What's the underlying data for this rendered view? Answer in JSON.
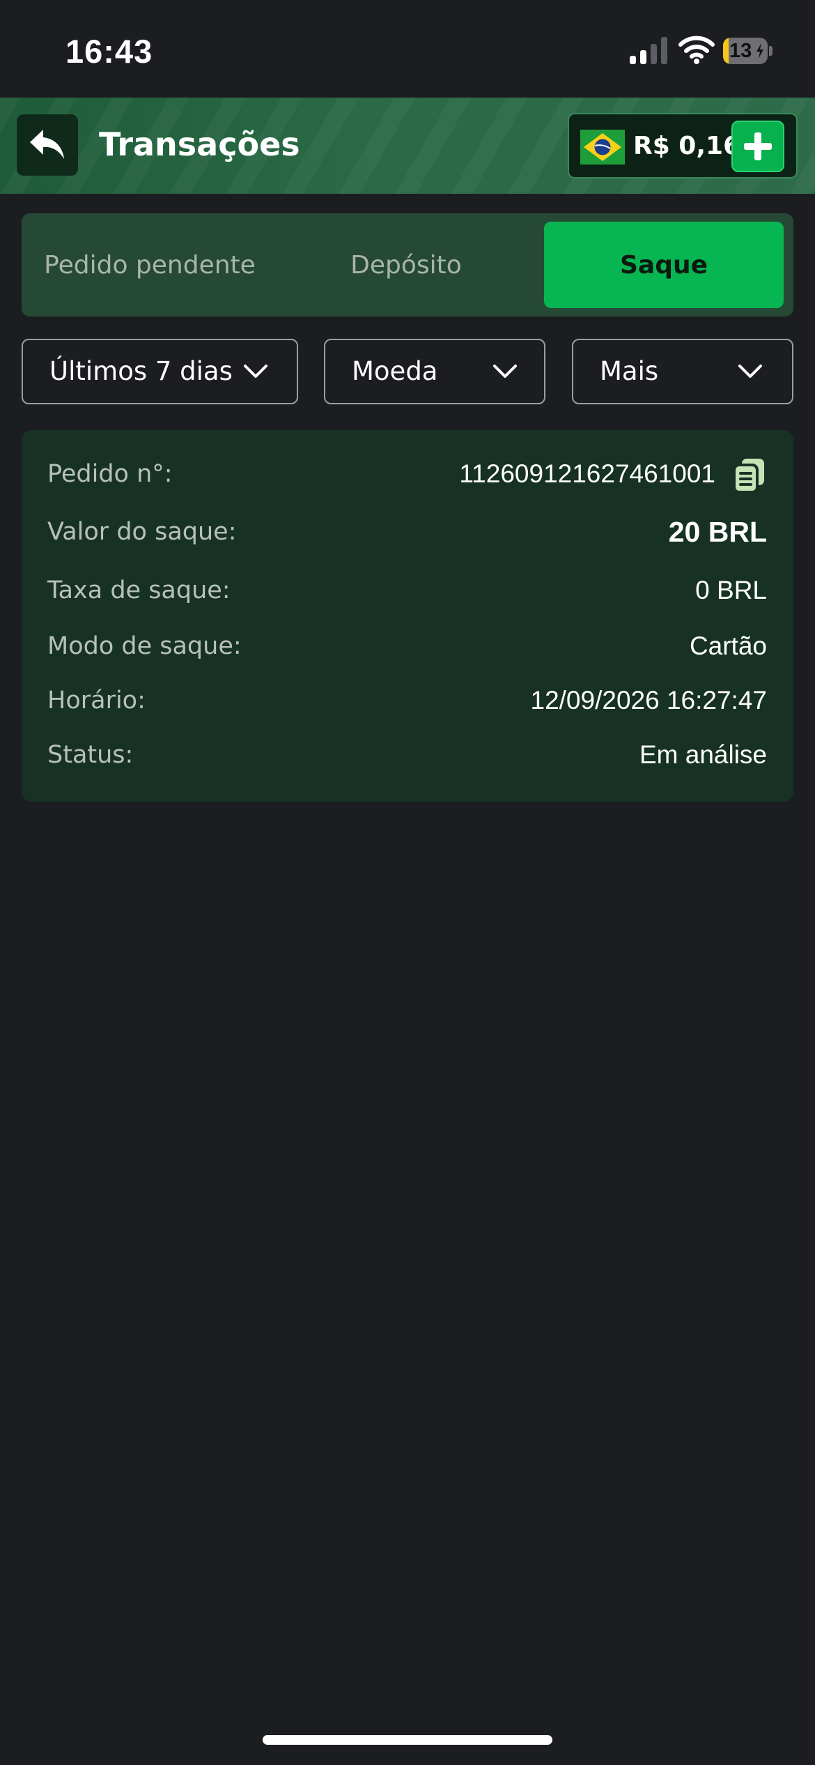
{
  "status_bar": {
    "time": "16:43",
    "battery": "13",
    "battery_level": 0.13
  },
  "header": {
    "title": "Transações",
    "balance": "R$ 0,16",
    "icons": [
      "back-arrow-icon",
      "brazil-flag-icon",
      "plus-icon"
    ]
  },
  "tabs": [
    {
      "label": "Pedido pendente",
      "active": false
    },
    {
      "label": "Depósito",
      "active": false
    },
    {
      "label": "Saque",
      "active": true
    }
  ],
  "filters": [
    {
      "label": "Últimos 7 dias"
    },
    {
      "label": "Moeda"
    },
    {
      "label": "Mais"
    }
  ],
  "transaction": {
    "order_label": "Pedido n°:",
    "order_value": "112609121627461001",
    "amount_label": "Valor do saque:",
    "amount_value": "20 BRL",
    "fee_label": "Taxa de saque:",
    "fee_value": "0 BRL",
    "mode_label": "Modo de saque:",
    "mode_value": "Cartão",
    "time_label": "Horário:",
    "time_value": "12/09/2026 16:27:47",
    "status_label": "Status:",
    "status_value": "Em análise"
  },
  "colors": {
    "background": "#1c1d21",
    "accent_green": "#07b553",
    "card": "#173224",
    "tabs_bg": "#264935"
  }
}
